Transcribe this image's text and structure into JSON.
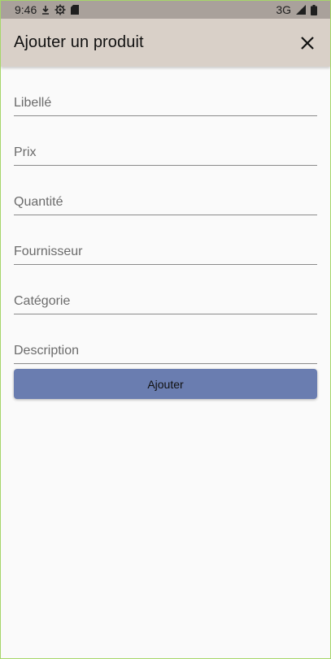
{
  "status": {
    "time": "9:46",
    "network": "3G",
    "icons": [
      "download-icon",
      "gear-icon",
      "sim-card-icon",
      "signal-icon",
      "battery-icon"
    ]
  },
  "appbar": {
    "title": "Ajouter un produit",
    "close_icon": "close-icon"
  },
  "form": {
    "fields": [
      {
        "placeholder": "Libellé",
        "value": ""
      },
      {
        "placeholder": "Prix",
        "value": ""
      },
      {
        "placeholder": "Quantité",
        "value": ""
      },
      {
        "placeholder": "Fournisseur",
        "value": ""
      },
      {
        "placeholder": "Catégorie",
        "value": ""
      },
      {
        "placeholder": "Description",
        "value": ""
      }
    ],
    "submit_label": "Ajouter"
  },
  "colors": {
    "status_bar": "#a9a19b",
    "appbar": "#d9d0c8",
    "button": "#6a7db0",
    "background": "#fafafa"
  }
}
